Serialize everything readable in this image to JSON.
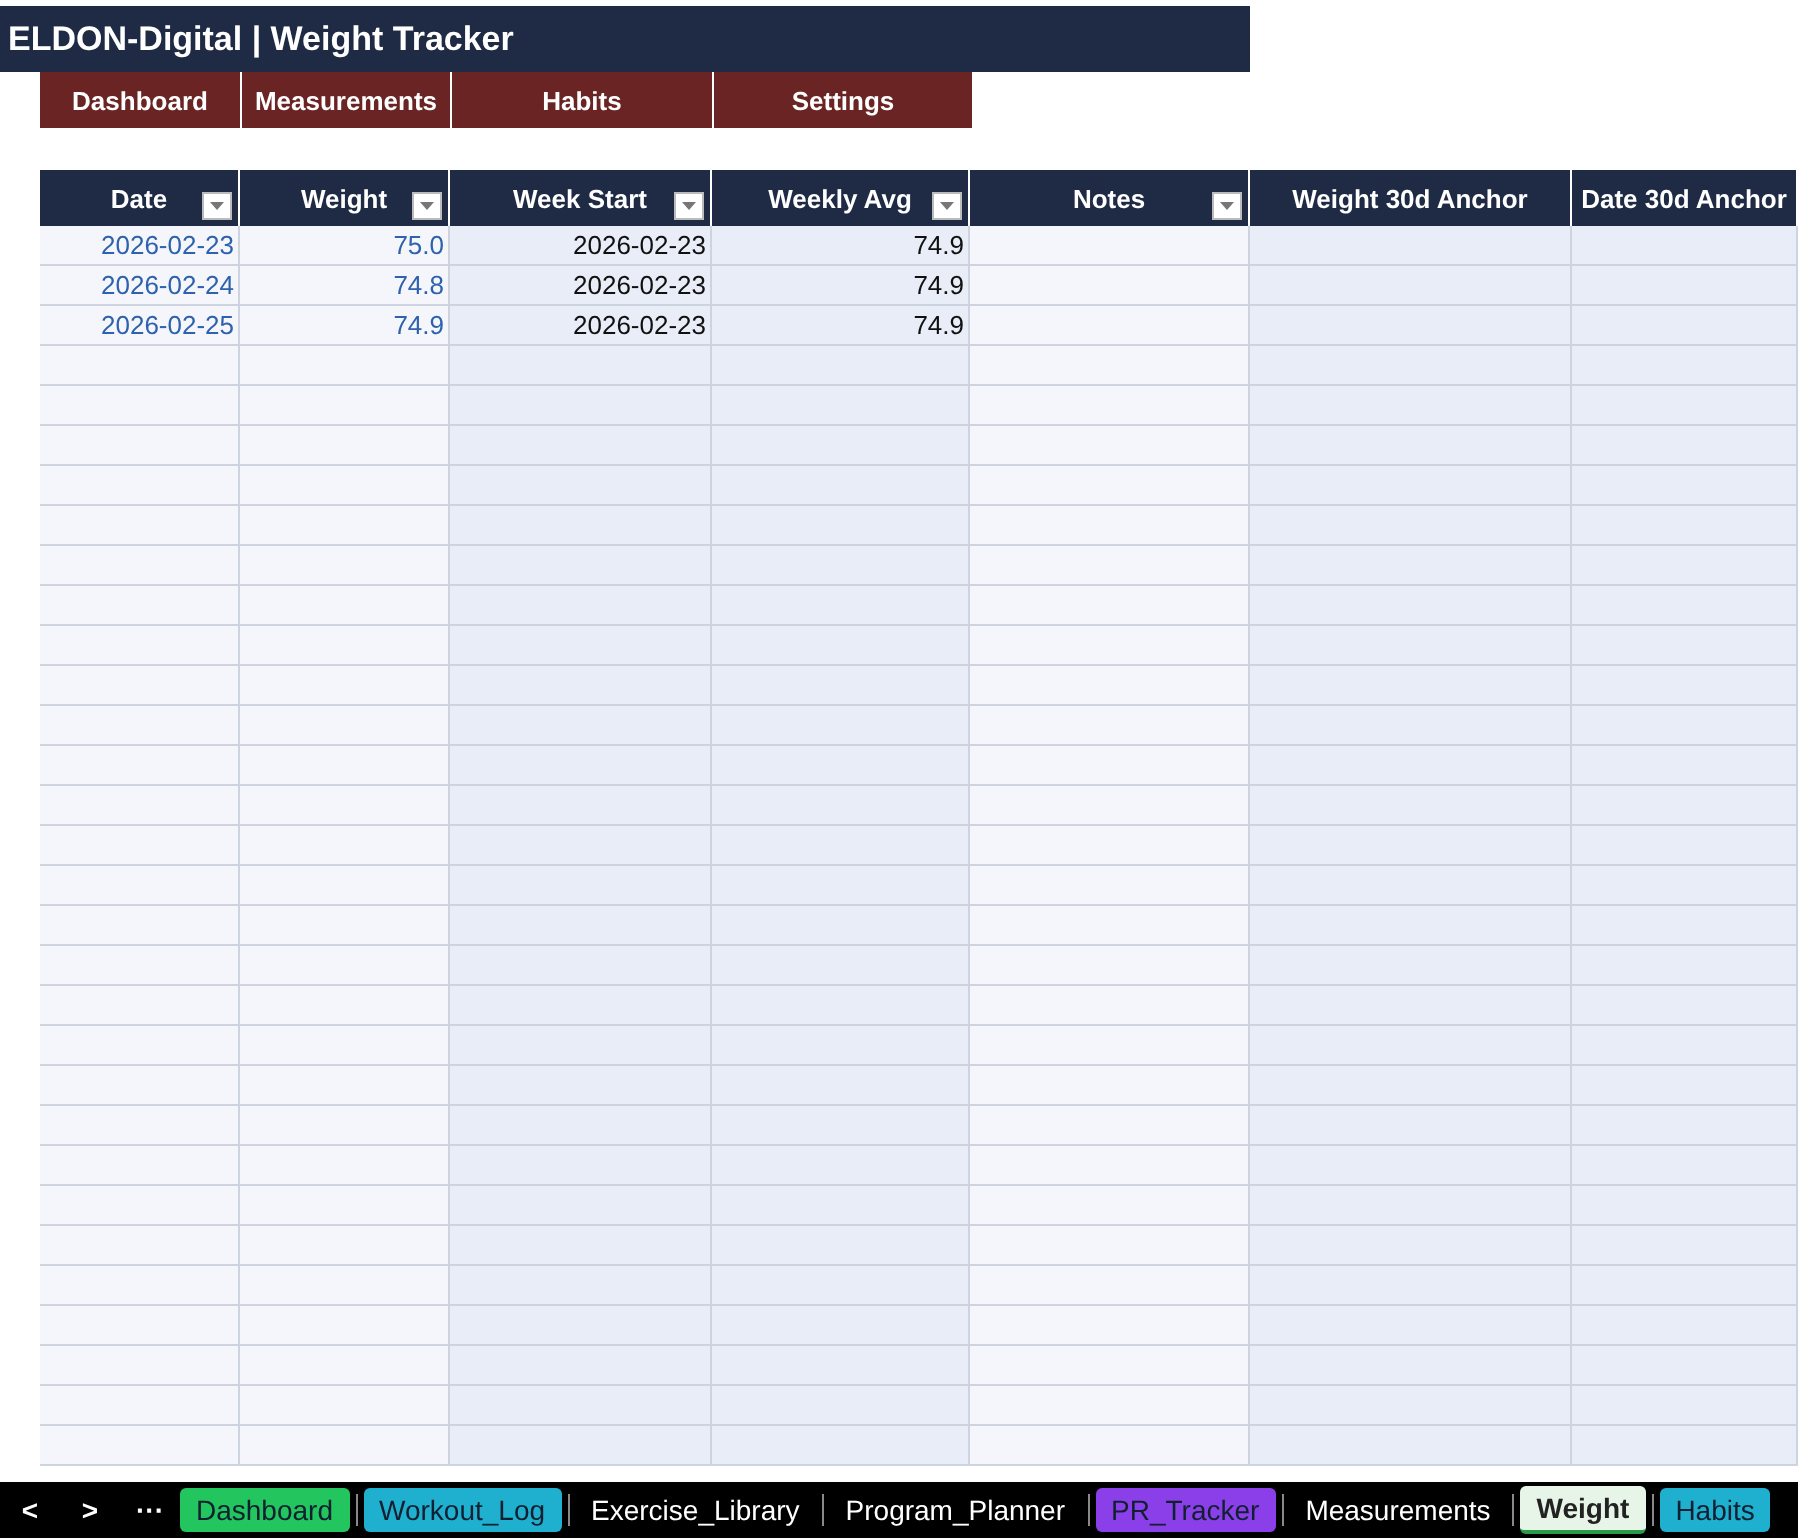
{
  "title": "ELDON-Digital | Weight Tracker",
  "nav_buttons": [
    "Dashboard",
    "Measurements",
    "Habits",
    "Settings"
  ],
  "table": {
    "columns": [
      {
        "label": "Date",
        "filter": true,
        "kind": "input"
      },
      {
        "label": "Weight",
        "filter": true,
        "kind": "input"
      },
      {
        "label": "Week Start",
        "filter": true,
        "kind": "formula"
      },
      {
        "label": "Weekly Avg",
        "filter": true,
        "kind": "formula"
      },
      {
        "label": "Notes",
        "filter": true,
        "kind": "input"
      },
      {
        "label": "Weight 30d Anchor",
        "filter": false,
        "kind": "formula"
      },
      {
        "label": "Date 30d Anchor",
        "filter": false,
        "kind": "formula"
      }
    ],
    "rows": [
      [
        "2026-02-23",
        "75.0",
        "2026-02-23",
        "74.9"
      ],
      [
        "2026-02-24",
        "74.8",
        "2026-02-23",
        "74.9"
      ],
      [
        "2026-02-25",
        "74.9",
        "2026-02-23",
        "74.9"
      ]
    ]
  },
  "sheet_nav": [
    "<",
    ">",
    "···"
  ],
  "sheet_tabs": [
    {
      "label": "Dashboard",
      "selected": false,
      "color": "#22c55e"
    },
    {
      "label": "Workout_Log",
      "selected": false,
      "color": "#1fb0d0"
    },
    {
      "label": "Exercise_Library",
      "selected": false
    },
    {
      "label": "Program_Planner",
      "selected": false
    },
    {
      "label": "PR_Tracker",
      "selected": false,
      "color": "#8b3fe8"
    },
    {
      "label": "Measurements",
      "selected": false
    },
    {
      "label": "Weight",
      "selected": true
    },
    {
      "label": "Habits",
      "selected": false,
      "color": "#1fb0d0"
    }
  ]
}
